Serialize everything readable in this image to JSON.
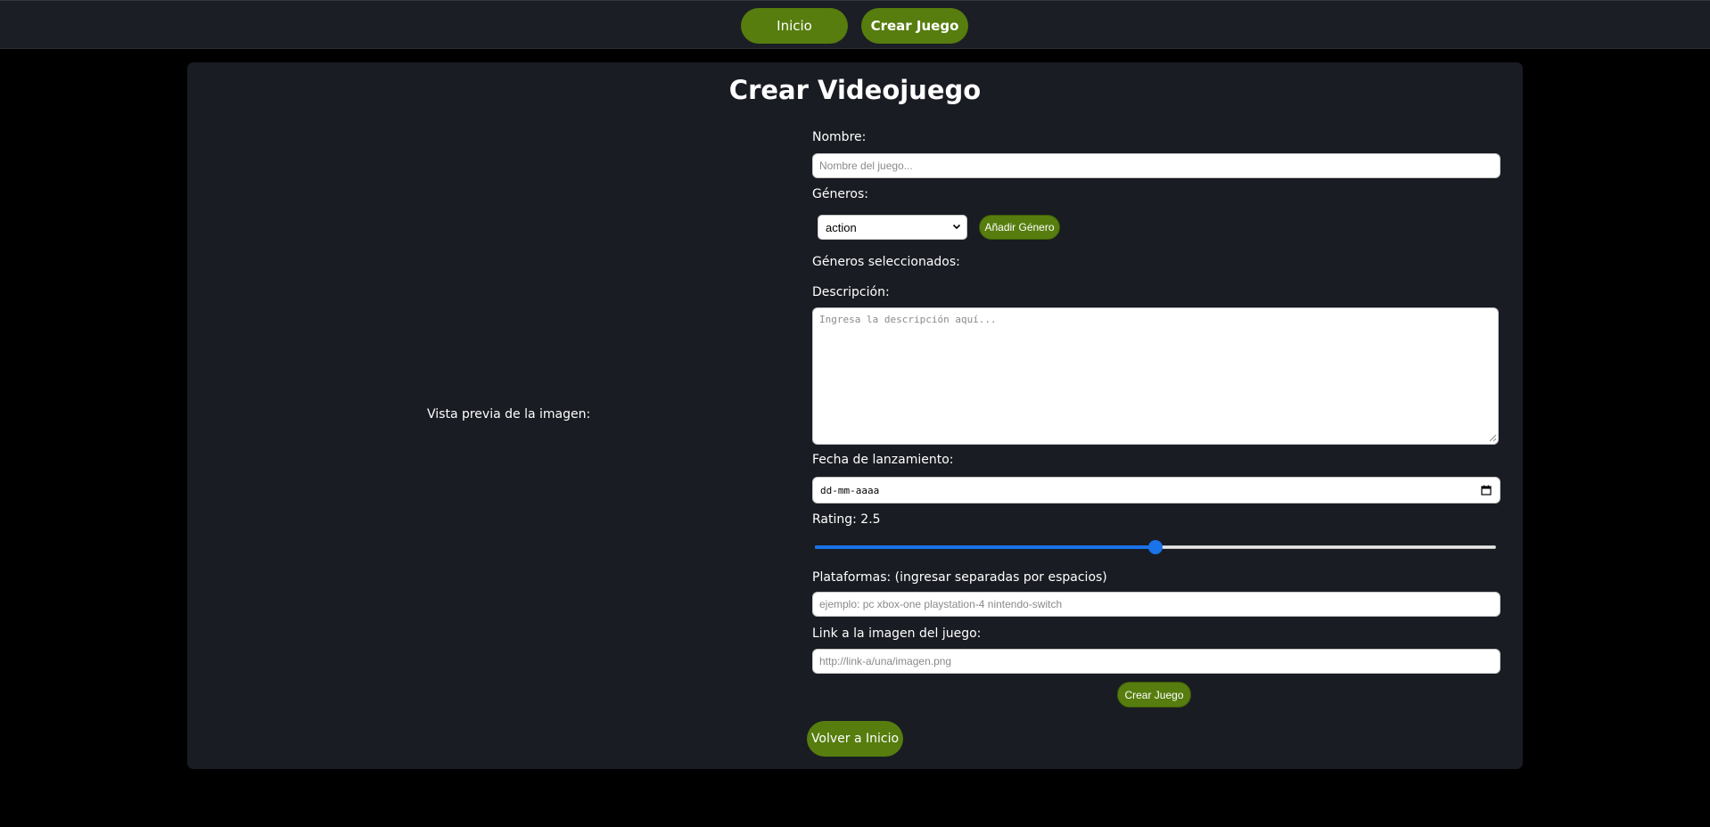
{
  "nav": {
    "home_label": "Inicio",
    "create_label": "Crear Juego"
  },
  "page": {
    "title": "Crear Videojuego",
    "preview_label": "Vista previa de la imagen:"
  },
  "form": {
    "name": {
      "label": "Nombre:",
      "value": "",
      "placeholder": "Nombre del juego..."
    },
    "genres": {
      "label": "Géneros:",
      "selected_option": "action",
      "add_button_label": "Añadir Género",
      "selected_label": "Géneros seleccionados:"
    },
    "description": {
      "label": "Descripción:",
      "value": "",
      "placeholder": "Ingresa la descripción aquí..."
    },
    "release_date": {
      "label": "Fecha de lanzamiento:",
      "placeholder": "dd-mm-aaaa"
    },
    "rating": {
      "label": "Rating: 2.5",
      "value": 2.5,
      "min": 0,
      "max": 5
    },
    "platforms": {
      "label": "Plataformas: (ingresar separadas por espacios)",
      "value": "",
      "placeholder": "ejemplo: pc xbox-one playstation-4 nintendo-switch"
    },
    "image_link": {
      "label": "Link a la imagen del juego:",
      "value": "",
      "placeholder": "http://link-a/una/imagen.png"
    },
    "submit_label": "Crear Juego"
  },
  "back_button_label": "Volver a Inicio",
  "colors": {
    "background": "#000000",
    "navbar": "#1b1e24",
    "card": "#191c22",
    "accent_green": "#567d0e",
    "slider_blue": "#1a73e8"
  },
  "icons": {
    "select_chevron": "chevron-down-icon",
    "date_picker": "calendar-icon",
    "textarea_grip": "resize-grip-icon"
  }
}
